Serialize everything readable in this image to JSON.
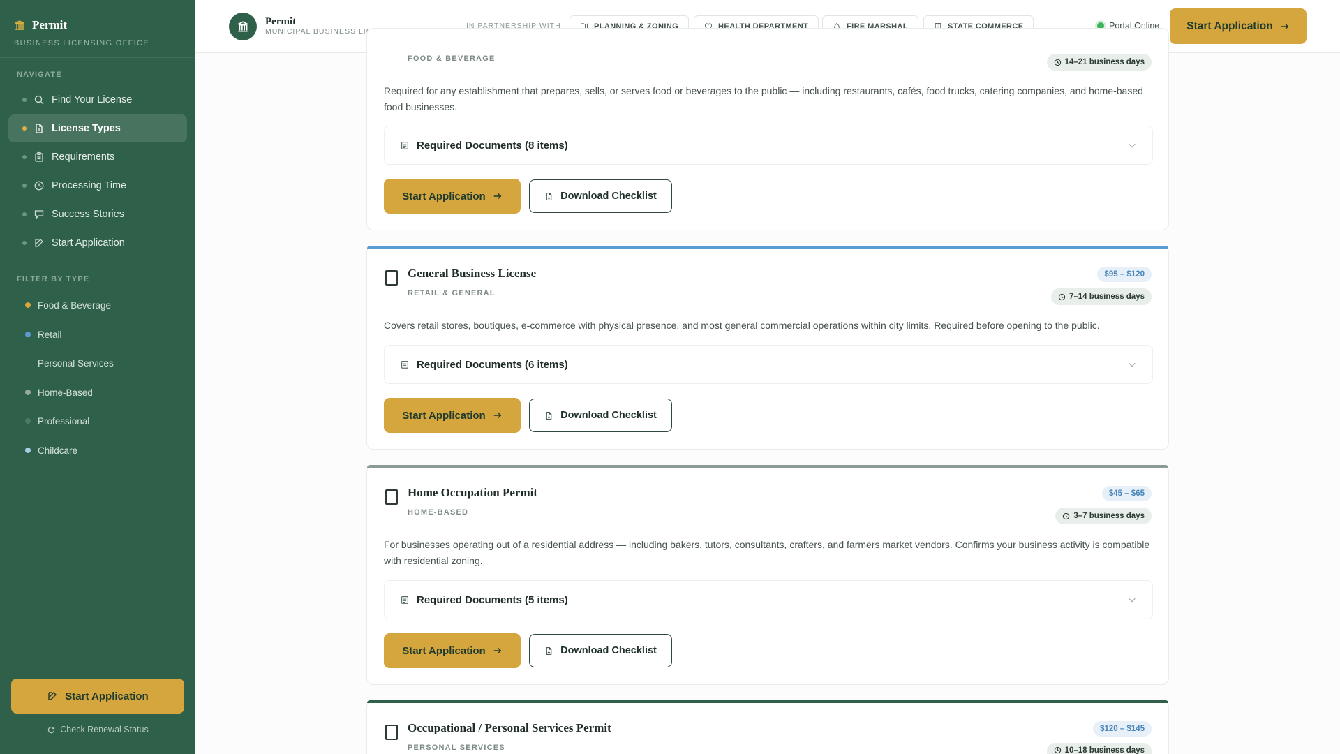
{
  "sidebar": {
    "brand_name": "Permit",
    "brand_subtitle": "BUSINESS LICENSING OFFICE",
    "navigate_label": "NAVIGATE",
    "nav": [
      {
        "label": "Find Your License",
        "icon": "search-icon"
      },
      {
        "label": "License Types",
        "icon": "document-icon",
        "active": true
      },
      {
        "label": "Requirements",
        "icon": "clipboard-icon"
      },
      {
        "label": "Processing Time",
        "icon": "clock-icon"
      },
      {
        "label": "Success Stories",
        "icon": "chat-icon"
      },
      {
        "label": "Start Application",
        "icon": "edit-icon"
      }
    ],
    "filter_label": "FILTER BY TYPE",
    "filters": [
      {
        "label": "Food & Beverage",
        "color": "#d5a53e"
      },
      {
        "label": "Retail",
        "color": "#5a9bd4"
      },
      {
        "label": "Personal Services",
        "color": "#2f6049"
      },
      {
        "label": "Home-Based",
        "color": "#9aa8a1"
      },
      {
        "label": "Professional",
        "color": "#4d7a65"
      },
      {
        "label": "Childcare",
        "color": "#a9cde8"
      }
    ],
    "cta_label": "Start Application",
    "renew_label": "Check Renewal Status"
  },
  "header": {
    "title": "Permit",
    "subtitle": "MUNICIPAL BUSINESS LICENSING",
    "partnership_label": "IN PARTNERSHIP WITH",
    "partners": [
      {
        "label": "PLANNING & ZONING",
        "icon": "map-icon"
      },
      {
        "label": "HEALTH DEPARTMENT",
        "icon": "heart-icon"
      },
      {
        "label": "FIRE MARSHAL",
        "icon": "flame-icon"
      },
      {
        "label": "STATE COMMERCE",
        "icon": "building-icon"
      }
    ],
    "status_label": "Portal Online",
    "status_color": "#3cb45a",
    "cta_label": "Start Application"
  },
  "cards": [
    {
      "category": "FOOD & BEVERAGE",
      "days": "14–21 business days",
      "description": "Required for any establishment that prepares, sells, or serves food or beverages to the public — including restaurants, cafés, food trucks, catering companies, and home-based food businesses.",
      "docs_label": "Required Documents (8 items)",
      "start_label": "Start Application",
      "download_label": "Download Checklist"
    },
    {
      "title": "General Business License",
      "category": "RETAIL & GENERAL",
      "fee": "$95 – $120",
      "days": "7–14 business days",
      "description": "Covers retail stores, boutiques, e-commerce with physical presence, and most general commercial operations within city limits. Required before opening to the public.",
      "docs_label": "Required Documents (6 items)",
      "start_label": "Start Application",
      "download_label": "Download Checklist",
      "accent": "#5a9bd4"
    },
    {
      "title": "Home Occupation Permit",
      "category": "HOME-BASED",
      "fee": "$45 – $65",
      "days": "3–7 business days",
      "description": "For businesses operating out of a residential address — including bakers, tutors, consultants, crafters, and farmers market vendors. Confirms your business activity is compatible with residential zoning.",
      "docs_label": "Required Documents (5 items)",
      "start_label": "Start Application",
      "download_label": "Download Checklist",
      "accent": "#8c9b94"
    },
    {
      "title": "Occupational / Personal Services Permit",
      "category": "PERSONAL SERVICES",
      "fee": "$120 – $145",
      "days": "10–18 business days",
      "accent": "#2f6049"
    }
  ]
}
